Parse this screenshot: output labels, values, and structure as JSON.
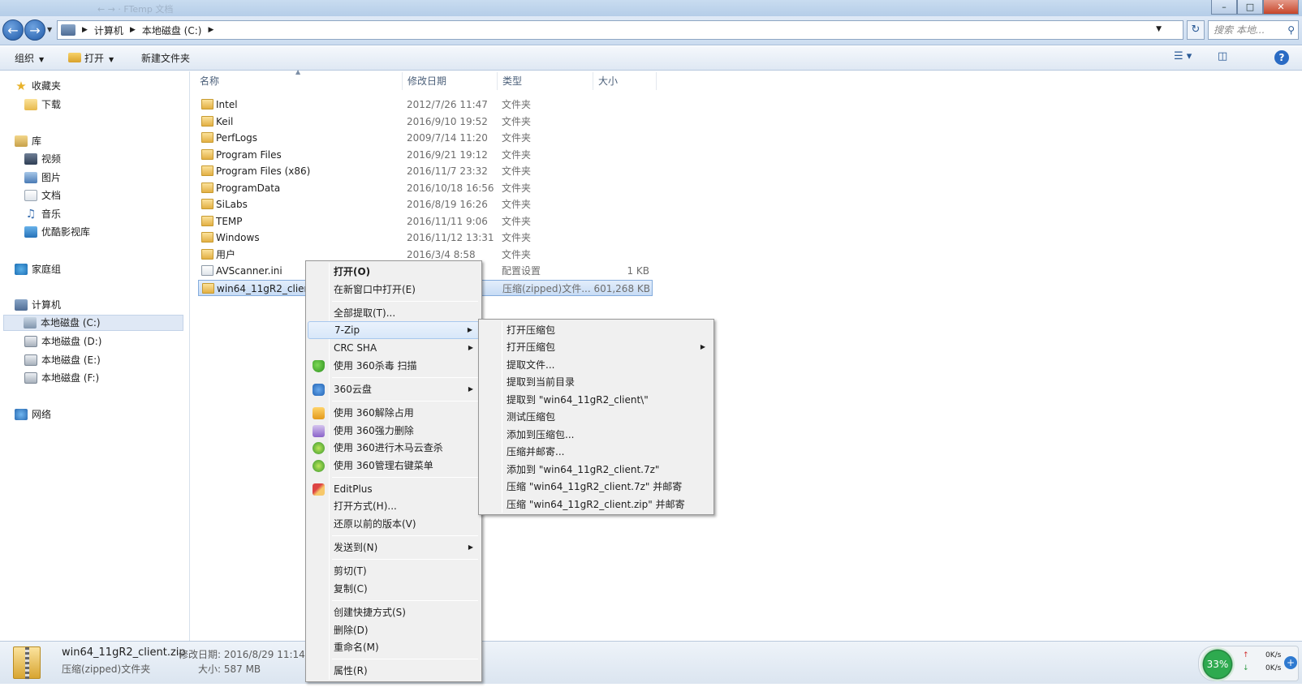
{
  "window": {
    "title_faded": "← → · FTemp   文档",
    "controls": [
      "–",
      "□",
      "✕"
    ]
  },
  "address": {
    "crumbs": [
      "计算机",
      "本地磁盘 (C:)"
    ],
    "search_placeholder": "搜索 本地..."
  },
  "toolbar": {
    "organize": "组织",
    "open": "打开",
    "new_folder": "新建文件夹"
  },
  "nav": {
    "favorites": "收藏夹",
    "downloads": "下载",
    "libraries": "库",
    "videos": "视频",
    "pictures": "图片",
    "documents": "文档",
    "music": "音乐",
    "youku": "优酷影视库",
    "homegroup": "家庭组",
    "computer": "计算机",
    "drive_c": "本地磁盘 (C:)",
    "drive_d": "本地磁盘 (D:)",
    "drive_e": "本地磁盘 (E:)",
    "drive_f": "本地磁盘 (F:)",
    "network": "网络"
  },
  "columns": {
    "name": "名称",
    "modified": "修改日期",
    "type": "类型",
    "size": "大小"
  },
  "files": [
    {
      "name": "Intel",
      "date": "2012/7/26 11:47",
      "type": "文件夹",
      "size": ""
    },
    {
      "name": "Keil",
      "date": "2016/9/10 19:52",
      "type": "文件夹",
      "size": ""
    },
    {
      "name": "PerfLogs",
      "date": "2009/7/14 11:20",
      "type": "文件夹",
      "size": ""
    },
    {
      "name": "Program Files",
      "date": "2016/9/21 19:12",
      "type": "文件夹",
      "size": ""
    },
    {
      "name": "Program Files (x86)",
      "date": "2016/11/7 23:32",
      "type": "文件夹",
      "size": ""
    },
    {
      "name": "ProgramData",
      "date": "2016/10/18 16:56",
      "type": "文件夹",
      "size": ""
    },
    {
      "name": "SiLabs",
      "date": "2016/8/19 16:26",
      "type": "文件夹",
      "size": ""
    },
    {
      "name": "TEMP",
      "date": "2016/11/11 9:06",
      "type": "文件夹",
      "size": ""
    },
    {
      "name": "Windows",
      "date": "2016/11/12 13:31",
      "type": "文件夹",
      "size": ""
    },
    {
      "name": "用户",
      "date": "2016/3/4 8:58",
      "type": "文件夹",
      "size": ""
    },
    {
      "name": "AVScanner.ini",
      "date": "",
      "type": "配置设置",
      "size": "1 KB"
    },
    {
      "name": "win64_11gR2_client.",
      "date": "",
      "type": "压缩(zipped)文件...",
      "size": "601,268 KB"
    }
  ],
  "details": {
    "filename": "win64_11gR2_client.zip",
    "modified_label": "修改日期: 2016/8/29 11:14",
    "type": "压缩(zipped)文件夹",
    "size_label": "大小: 587 MB"
  },
  "gadget": {
    "percent": "33%",
    "up_speed": "0K/s",
    "down_speed": "0K/s"
  },
  "context_menu": {
    "open": "打开(O)",
    "open_new_window": "在新窗口中打开(E)",
    "extract_all": "全部提取(T)...",
    "seven_zip": "7-Zip",
    "crc_sha": "CRC SHA",
    "scan_360": "使用 360杀毒 扫描",
    "cloud_360": "360云盘",
    "unlock_360": "使用 360解除占用",
    "force_delete_360": "使用 360强力删除",
    "trojan_scan_360": "使用 360进行木马云查杀",
    "manage_menu_360": "使用 360管理右键菜单",
    "editplus": "EditPlus",
    "open_with": "打开方式(H)...",
    "restore_versions": "还原以前的版本(V)",
    "send_to": "发送到(N)",
    "cut": "剪切(T)",
    "copy": "复制(C)",
    "create_shortcut": "创建快捷方式(S)",
    "delete": "删除(D)",
    "rename": "重命名(M)",
    "properties": "属性(R)"
  },
  "zip_submenu": [
    "打开压缩包",
    "打开压缩包",
    "提取文件...",
    "提取到当前目录",
    "提取到 \"win64_11gR2_client\\\"",
    "测试压缩包",
    "添加到压缩包...",
    "压缩并邮寄...",
    "添加到 \"win64_11gR2_client.7z\"",
    "压缩 \"win64_11gR2_client.7z\" 并邮寄",
    "压缩 \"win64_11gR2_client.zip\" 并邮寄"
  ]
}
